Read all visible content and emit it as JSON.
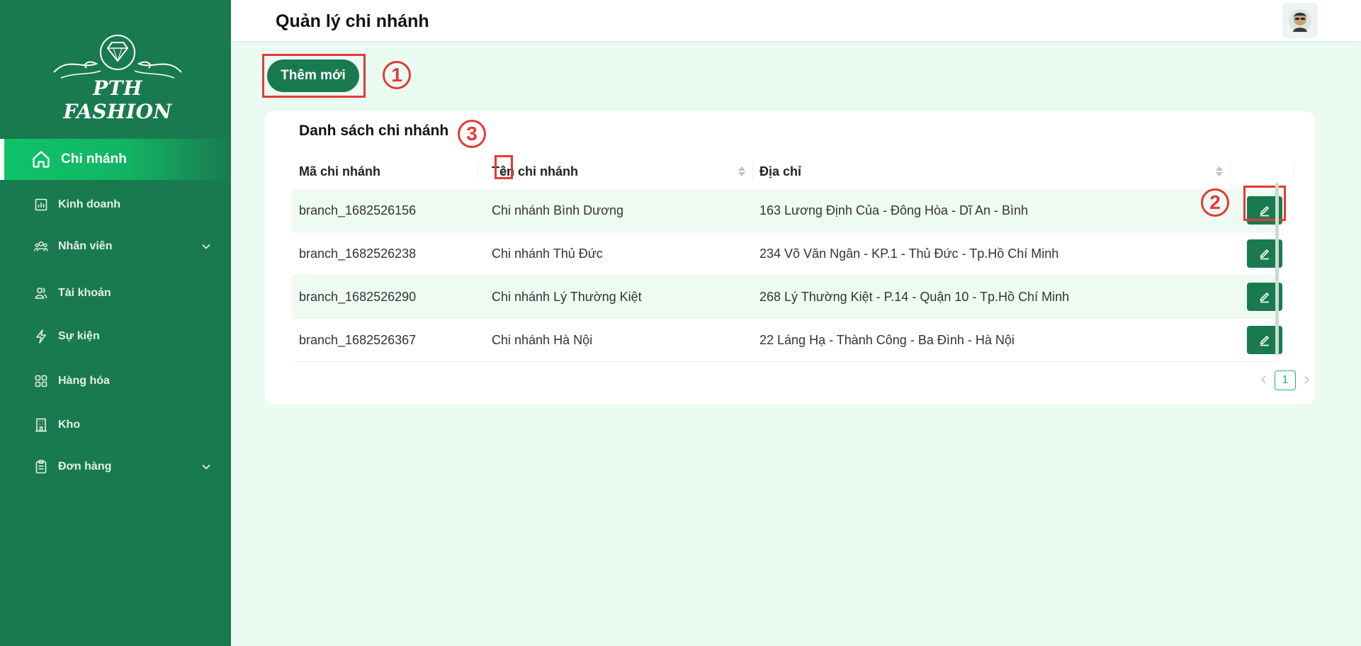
{
  "brand": {
    "name": "PTH FASHION"
  },
  "sidebar": {
    "items": [
      {
        "label": "Chi nhánh",
        "icon": "home-icon",
        "active": true
      },
      {
        "label": "Kinh doanh",
        "icon": "bar-chart-icon"
      },
      {
        "label": "Nhân viên",
        "icon": "team-icon",
        "expandable": true
      },
      {
        "label": "Tài khoản",
        "icon": "users-icon"
      },
      {
        "label": "Sự kiện",
        "icon": "lightning-icon"
      },
      {
        "label": "Hàng hóa",
        "icon": "grid-icon"
      },
      {
        "label": "Kho",
        "icon": "building-icon"
      },
      {
        "label": "Đơn hàng",
        "icon": "clipboard-icon",
        "expandable": true
      }
    ]
  },
  "header": {
    "title": "Quản lý chi nhánh"
  },
  "toolbar": {
    "add_label": "Thêm mới"
  },
  "annotations": {
    "badge1": "1",
    "badge2": "2",
    "badge3": "3"
  },
  "table": {
    "title": "Danh sách chi nhánh",
    "columns": [
      "Mã chi nhánh",
      "Tên chi nhánh",
      "Địa chỉ"
    ],
    "rows": [
      [
        "branch_1682526156",
        "Chi nhánh Bình Dương",
        "163 Lương Định Của - Đông Hòa - Dĩ An - Bình"
      ],
      [
        "branch_1682526238",
        "Chi nhánh Thủ Đức",
        "234 Võ Văn Ngân - KP.1 - Thủ Đức - Tp.Hồ Chí Minh"
      ],
      [
        "branch_1682526290",
        "Chi nhánh Lý Thường Kiệt",
        "268 Lý Thường Kiệt - P.14 - Quận 10 - Tp.Hồ Chí Minh"
      ],
      [
        "branch_1682526367",
        "Chi nhánh Hà Nội",
        "22 Láng Hạ - Thành Công - Ba Đình - Hà Nội"
      ]
    ]
  },
  "pagination": {
    "current": "1"
  },
  "colors": {
    "sidebar_bg": "#1a7a4f",
    "accent": "#1a7a4f",
    "active_gradient": "#0fc46a",
    "page_bg": "#eafbf2",
    "annotation_red": "#e53935"
  }
}
